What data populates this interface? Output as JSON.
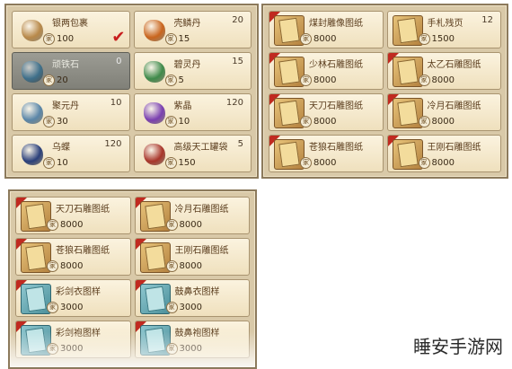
{
  "panels": {
    "left_top": [
      {
        "name": "银两包裹",
        "qty": "",
        "price": "100",
        "icon": "money-pouch-icon",
        "color": "#b8894a",
        "checked": true
      },
      {
        "name": "壳鳞丹",
        "qty": "20",
        "price": "15",
        "icon": "pill-icon",
        "color": "#c9651e"
      },
      {
        "name": "顽铁石",
        "qty": "0",
        "price": "20",
        "icon": "ore-icon",
        "color": "#3e6f8a",
        "selected": true
      },
      {
        "name": "碧灵丹",
        "qty": "15",
        "price": "5",
        "icon": "green-herb-icon",
        "color": "#3f8a4a"
      },
      {
        "name": "聚元丹",
        "qty": "10",
        "price": "30",
        "icon": "pill-tray-icon",
        "color": "#5a86a8"
      },
      {
        "name": "紫晶",
        "qty": "120",
        "price": "10",
        "icon": "crystal-icon",
        "color": "#7a3fb0"
      },
      {
        "name": "乌蝶",
        "qty": "120",
        "price": "10",
        "icon": "bottle-icon",
        "color": "#2a3f7a"
      },
      {
        "name": "高级天工罐袋",
        "qty": "5",
        "price": "150",
        "icon": "bag-icon",
        "color": "#a8352a"
      }
    ],
    "right_top": [
      {
        "name": "煤封雕像图纸",
        "qty": "",
        "price": "8000",
        "blue": false,
        "tag": true
      },
      {
        "name": "手札残页",
        "qty": "12",
        "price": "1500",
        "blue": false
      },
      {
        "name": "少林石雕图纸",
        "qty": "",
        "price": "8000",
        "blue": false,
        "tag": true
      },
      {
        "name": "太乙石雕图纸",
        "qty": "",
        "price": "8000",
        "blue": false,
        "tag": true
      },
      {
        "name": "天刀石雕图纸",
        "qty": "",
        "price": "8000",
        "blue": false,
        "tag": true
      },
      {
        "name": "冷月石雕图纸",
        "qty": "",
        "price": "8000",
        "blue": false,
        "tag": true
      },
      {
        "name": "苍狼石雕图纸",
        "qty": "",
        "price": "8000",
        "blue": false,
        "tag": true
      },
      {
        "name": "王刚石雕图纸",
        "qty": "",
        "price": "8000",
        "blue": false,
        "tag": true
      }
    ],
    "bottom_left": [
      {
        "name": "天刀石雕图纸",
        "qty": "",
        "price": "8000",
        "blue": false,
        "tag": true
      },
      {
        "name": "冷月石雕图纸",
        "qty": "",
        "price": "8000",
        "blue": false,
        "tag": true
      },
      {
        "name": "苍狼石雕图纸",
        "qty": "",
        "price": "8000",
        "blue": false,
        "tag": true
      },
      {
        "name": "王刚石雕图纸",
        "qty": "",
        "price": "8000",
        "blue": false,
        "tag": true
      },
      {
        "name": "彩剑衣图样",
        "qty": "",
        "price": "3000",
        "blue": true,
        "tag": true
      },
      {
        "name": "鼓鼻衣图样",
        "qty": "",
        "price": "3000",
        "blue": true,
        "tag": true
      },
      {
        "name": "彩剑袍图样",
        "qty": "",
        "price": "3000",
        "blue": true,
        "tag": true
      },
      {
        "name": "鼓鼻袍图样",
        "qty": "",
        "price": "3000",
        "blue": true,
        "tag": true
      }
    ]
  },
  "currency_glyph": "家",
  "checkmark": "✔",
  "watermark": "睡安手游网"
}
